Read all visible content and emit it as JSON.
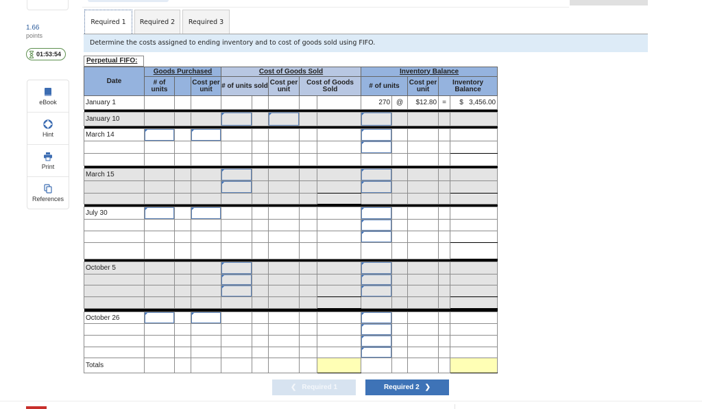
{
  "sidebar": {
    "points_value": "1.66",
    "points_label": "points",
    "timer": "01:53:54",
    "tools": [
      {
        "label": "eBook",
        "icon": "book-icon"
      },
      {
        "label": "Hint",
        "icon": "lifebuoy-icon"
      },
      {
        "label": "Print",
        "icon": "printer-icon"
      },
      {
        "label": "References",
        "icon": "copy-icon"
      }
    ]
  },
  "tabs": [
    {
      "label": "Required 1",
      "active": true
    },
    {
      "label": "Required 2",
      "active": false
    },
    {
      "label": "Required 3",
      "active": false
    }
  ],
  "instruction": "Determine the costs assigned to ending inventory and to cost of goods sold using FIFO.",
  "table": {
    "caption": "Perpetual FIFO:",
    "headers": {
      "date": "Date",
      "goods_purchased": "Goods Purchased",
      "cost_of_goods_sold": "Cost of Goods Sold",
      "inventory_balance": "Inventory Balance",
      "gp_units": "# of units",
      "gp_cost": "Cost per unit",
      "cogs_units": "# of units sold",
      "cogs_cost": "Cost per unit",
      "cogs_total": "Cost of Goods Sold",
      "ib_units": "# of units",
      "ib_cost": "Cost per unit",
      "ib_total": "Inventory Balance"
    },
    "colors": {
      "header_blue": "#95b3de",
      "header_cogs": "#b8c7e2",
      "input_border": "#5f86bd",
      "total_yellow": "#ffffb5"
    },
    "groups": [
      {
        "date": "January 1",
        "shade": "white",
        "rows": [
          {
            "cells": {
              "ib_units": "270",
              "ib_at": "@",
              "ib_cost": "$12.80",
              "ib_eq": "=",
              "ib_total": "$   3,456.00"
            },
            "inputs": {},
            "rule": []
          }
        ]
      },
      {
        "date": "January 10",
        "shade": "gray",
        "rows": [
          {
            "cells": {},
            "inputs": {
              "cogs_units": "",
              "cogs_cost": "",
              "ib_units": ""
            },
            "rule": []
          }
        ]
      },
      {
        "date": "March 14",
        "shade": "white",
        "rows": [
          {
            "cells": {},
            "inputs": {
              "gp_units": "",
              "gp_cost": "",
              "ib_units": ""
            },
            "rule": []
          },
          {
            "cells": {},
            "inputs": {
              "ib_units": ""
            },
            "rule": [
              "ib_total"
            ]
          },
          {
            "cells": {},
            "inputs": {},
            "rule": []
          }
        ]
      },
      {
        "date": "March 15",
        "shade": "gray",
        "rows": [
          {
            "cells": {},
            "inputs": {
              "cogs_units": "",
              "ib_units": ""
            },
            "rule": []
          },
          {
            "cells": {},
            "inputs": {
              "cogs_units": "",
              "ib_units": ""
            },
            "rule": [
              "cogs_total",
              "ib_total"
            ]
          },
          {
            "cells": {},
            "inputs": {},
            "rule": [
              "cogs_total"
            ]
          }
        ]
      },
      {
        "date": "July 30",
        "shade": "white",
        "rows": [
          {
            "cells": {},
            "inputs": {
              "gp_units": "",
              "gp_cost": "",
              "ib_units": ""
            },
            "rule": []
          },
          {
            "cells": {},
            "inputs": {
              "ib_units": ""
            },
            "rule": []
          },
          {
            "cells": {},
            "inputs": {
              "ib_units": ""
            },
            "rule": [
              "ib_total"
            ]
          },
          {
            "cells": {},
            "inputs": {},
            "rule": [
              "ib_total"
            ]
          }
        ]
      },
      {
        "date": "October 5",
        "shade": "gray",
        "rows": [
          {
            "cells": {},
            "inputs": {
              "cogs_units": "",
              "ib_units": ""
            },
            "rule": []
          },
          {
            "cells": {},
            "inputs": {
              "cogs_units": "",
              "ib_units": ""
            },
            "rule": []
          },
          {
            "cells": {},
            "inputs": {
              "cogs_units": "",
              "ib_units": ""
            },
            "rule": [
              "cogs_total",
              "ib_total"
            ]
          },
          {
            "cells": {},
            "inputs": {},
            "rule": [
              "cogs_total",
              "ib_total"
            ]
          }
        ]
      },
      {
        "date": "October 26",
        "shade": "white",
        "rows": [
          {
            "cells": {},
            "inputs": {
              "gp_units": "",
              "gp_cost": "",
              "ib_units": ""
            },
            "rule": []
          },
          {
            "cells": {},
            "inputs": {
              "ib_units": ""
            },
            "rule": []
          },
          {
            "cells": {},
            "inputs": {
              "ib_units": ""
            },
            "rule": []
          },
          {
            "cells": {},
            "inputs": {
              "ib_units": ""
            },
            "rule": []
          }
        ]
      }
    ],
    "totals": {
      "label": "Totals",
      "cogs_total": "",
      "ib_total": ""
    }
  },
  "navigation": {
    "prev_label": "Required 1",
    "prev_enabled": false,
    "next_label": "Required 2",
    "next_enabled": true
  }
}
